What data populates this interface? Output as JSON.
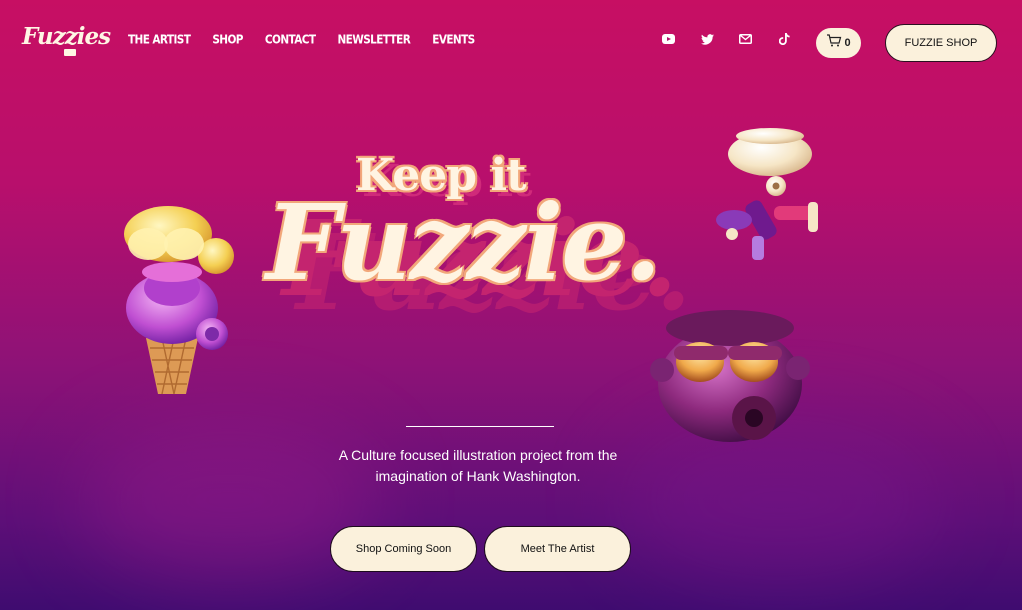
{
  "brand": {
    "logo_text": "Fuzzies",
    "logo_badge": "co"
  },
  "nav": {
    "items": [
      {
        "label": "THE ARTIST"
      },
      {
        "label": "SHOP"
      },
      {
        "label": "CONTACT"
      },
      {
        "label": "NEWSLETTER"
      },
      {
        "label": "EVENTS"
      }
    ]
  },
  "social": [
    "youtube-icon",
    "twitter-icon",
    "mail-icon",
    "tiktok-icon"
  ],
  "cart": {
    "count": "0"
  },
  "header_button": {
    "label": "FUZZIE SHOP"
  },
  "hero": {
    "line1": "Keep it",
    "line2": "Fuzzie.",
    "tagline": "A Culture focused illustration project from the imagination of Hank Washington."
  },
  "buttons": {
    "shop": "Shop Coming Soon",
    "artist": "Meet The Artist"
  },
  "colors": {
    "background_top": "#c70f63",
    "background_bottom": "#3f0c70",
    "cream": "#fbf1dc",
    "shadow_pink": "#c4246f"
  }
}
